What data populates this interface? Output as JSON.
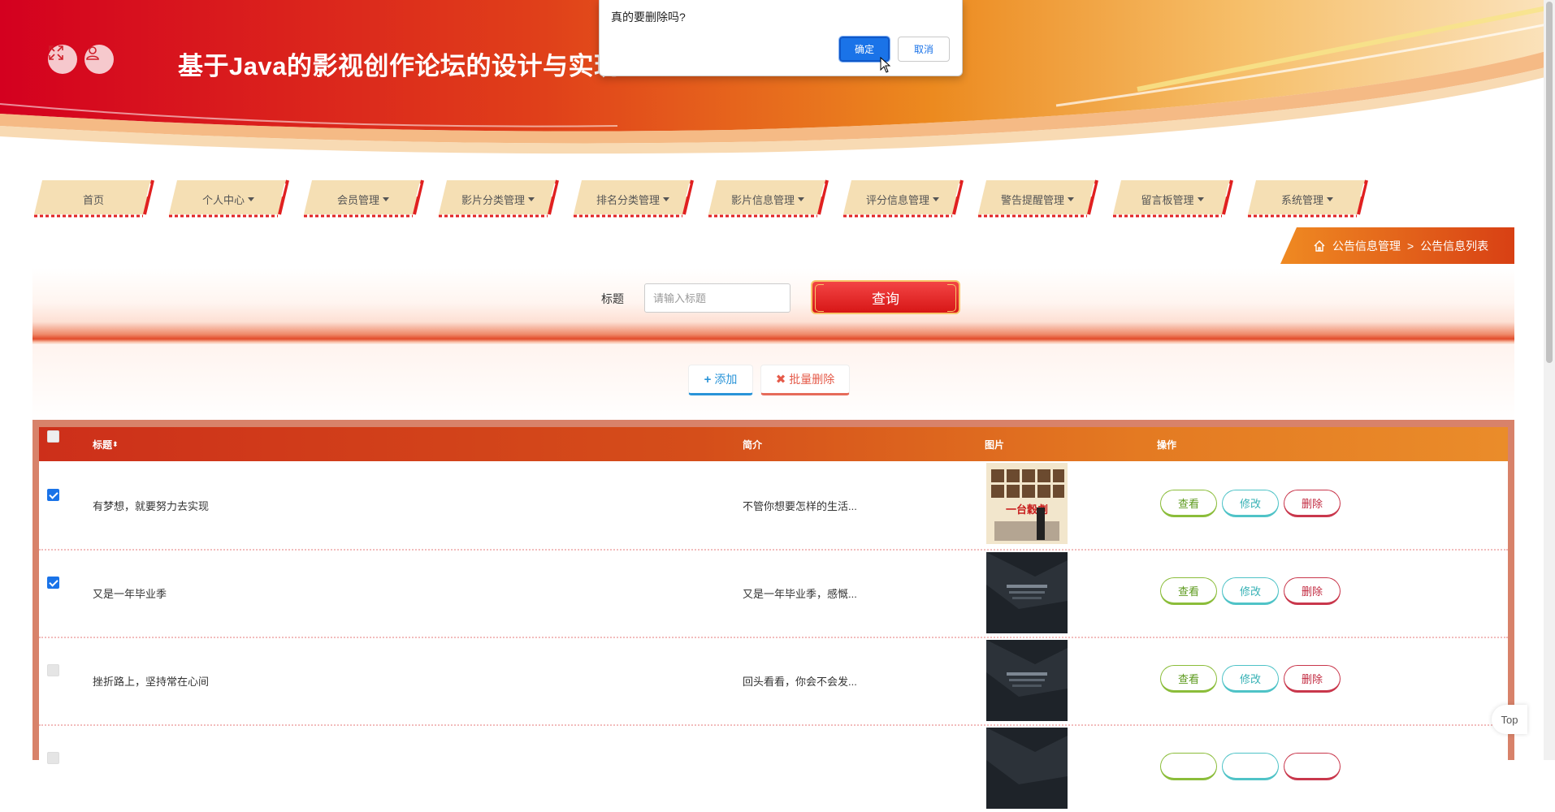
{
  "header": {
    "title": "基于Java的影视创作论坛的设计与实现",
    "fullscreen_icon": "expand-icon",
    "user_icon": "user-icon"
  },
  "nav": {
    "items": [
      {
        "label": "首页",
        "dropdown": false
      },
      {
        "label": "个人中心",
        "dropdown": true
      },
      {
        "label": "会员管理",
        "dropdown": true
      },
      {
        "label": "影片分类管理",
        "dropdown": true
      },
      {
        "label": "排名分类管理",
        "dropdown": true
      },
      {
        "label": "影片信息管理",
        "dropdown": true
      },
      {
        "label": "评分信息管理",
        "dropdown": true
      },
      {
        "label": "警告提醒管理",
        "dropdown": true
      },
      {
        "label": "留言板管理",
        "dropdown": true
      },
      {
        "label": "系统管理",
        "dropdown": true
      }
    ]
  },
  "breadcrumb": {
    "home_icon": "home-icon",
    "parent": "公告信息管理",
    "separator": ">",
    "current": "公告信息列表"
  },
  "search": {
    "label": "标题",
    "placeholder": "请输入标题",
    "query_button": "查询"
  },
  "actions": {
    "add": "添加",
    "batch_delete": "批量删除"
  },
  "table": {
    "columns": {
      "title": "标题",
      "summary": "简介",
      "image": "图片",
      "operation": "操作"
    },
    "rows": [
      {
        "checked": true,
        "title": "有梦想，就要努力去实现",
        "summary": "不管你想要怎样的生活...",
        "poster_caption": "一台穀劇"
      },
      {
        "checked": true,
        "title": "又是一年毕业季",
        "summary": "又是一年毕业季，感慨..."
      },
      {
        "checked": false,
        "title": "挫折路上，坚持常在心间",
        "summary": "回头看看，你会不会发..."
      }
    ],
    "row_buttons": {
      "view": "查看",
      "edit": "修改",
      "delete": "删除"
    }
  },
  "dialog": {
    "message": "真的要删除吗?",
    "ok": "确定",
    "cancel": "取消"
  },
  "back_to_top": "Top",
  "colors": {
    "primary_red": "#d71616",
    "header_orange": "#e9861f",
    "confirm_blue": "#1a73e8"
  }
}
